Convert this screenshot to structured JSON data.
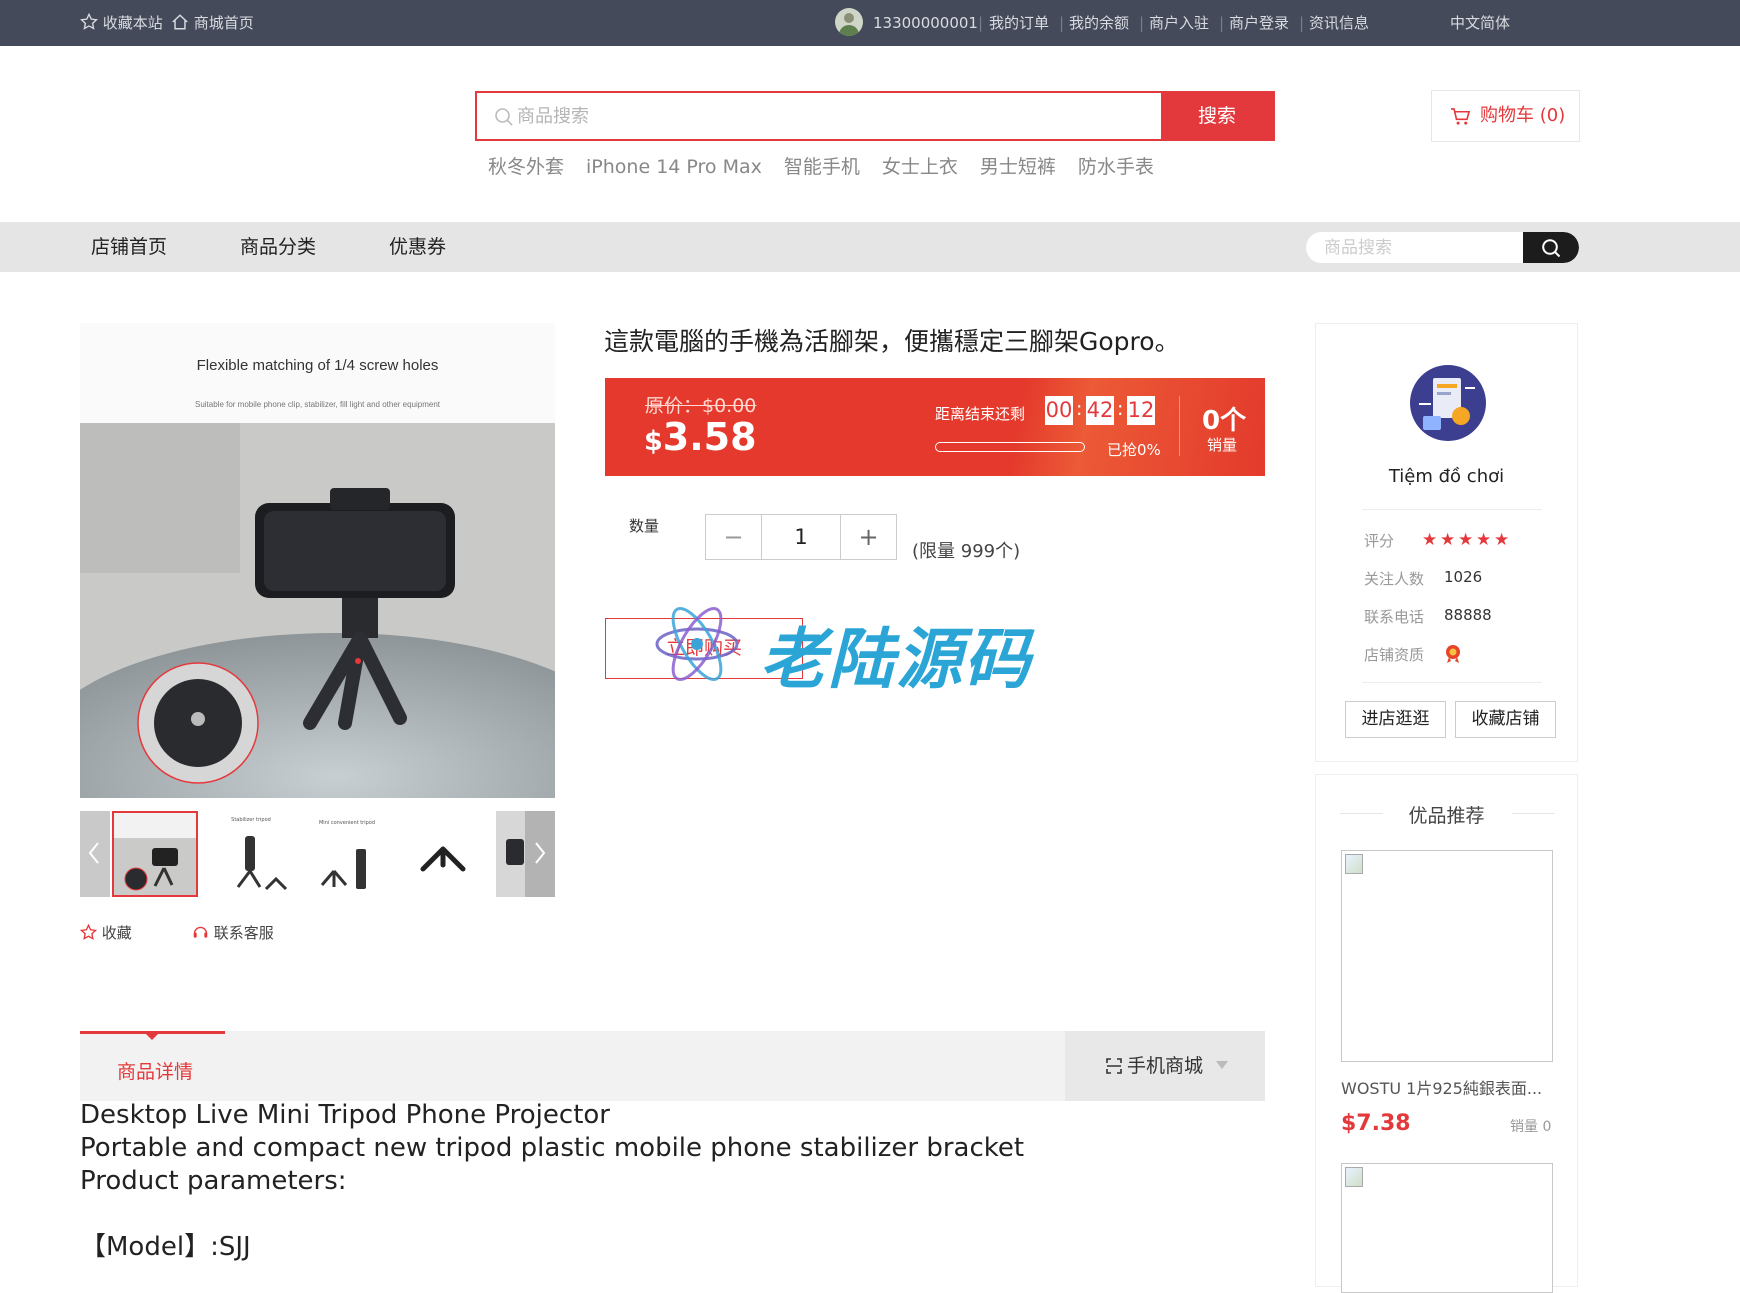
{
  "topbar": {
    "favorite_site": "收藏本站",
    "home": "商城首页",
    "phone": "13300000001",
    "my_orders": "我的订单",
    "my_balance": "我的余额",
    "merchant_join": "商户入驻",
    "merchant_login": "商户登录",
    "news": "资讯信息",
    "language": "中文简体"
  },
  "search": {
    "placeholder": "商品搜索",
    "button": "搜索",
    "hot_words": [
      "秋冬外套",
      "iPhone 14 Pro Max",
      "智能手机",
      "女士上衣",
      "男士短裤",
      "防水手表"
    ]
  },
  "cart": {
    "label": "购物车 (0)"
  },
  "nav": {
    "items": [
      "店铺首页",
      "商品分类",
      "优惠券"
    ],
    "search_placeholder": "商品搜索"
  },
  "gallery": {
    "headline": "Flexible matching of 1/4 screw holes",
    "subline": "Suitable for mobile phone clip, stabilizer, fill light and other equipment",
    "thumb_captions": [
      "Stabilizer tripod",
      "Mini convenient tripod"
    ],
    "favorite": "收藏",
    "contact": "联系客服"
  },
  "product": {
    "title": "這款電腦的手機為活腳架，便攜穩定三腳架Gopro。",
    "original_price": "原价：$0.00",
    "currency": "$",
    "price": "3.58",
    "countdown_label": "距离结束还剩",
    "countdown": {
      "h": "00",
      "m": "42",
      "s": "12"
    },
    "progress": 0,
    "grabbed": "已抢0%",
    "sold_count": "0个",
    "sold_label": "销量",
    "qty_label": "数量",
    "qty_value": "1",
    "qty_minus": "−",
    "qty_plus": "+",
    "limit": "(限量 999个)",
    "buy_now": "立即购买",
    "watermark": "老陆源码"
  },
  "store": {
    "name": "Tiệm đồ chơi",
    "rating_label": "评分",
    "rating": 5,
    "followers_label": "关注人数",
    "followers": "1026",
    "phone_label": "联系电话",
    "phone": "88888",
    "qualification_label": "店铺资质",
    "enter_store": "进店逛逛",
    "favorite_store": "收藏店铺"
  },
  "recommend": {
    "title": "优品推荐",
    "items": [
      {
        "name": "WOSTU 1片925純銀表面...",
        "price": "$7.38",
        "sales": "销量 0"
      }
    ]
  },
  "tabs": {
    "detail": "商品详情",
    "mobile": "手机商城"
  },
  "description": {
    "lines": [
      "Desktop Live Mini Tripod Phone Projector",
      "Portable and compact new tripod plastic mobile phone stabilizer bracket",
      "Product parameters:",
      "",
      "【Model】:SJJ"
    ]
  },
  "colors": {
    "accent": "#e4393c",
    "topbar": "#444a5a",
    "nav": "#e5e5e5"
  }
}
